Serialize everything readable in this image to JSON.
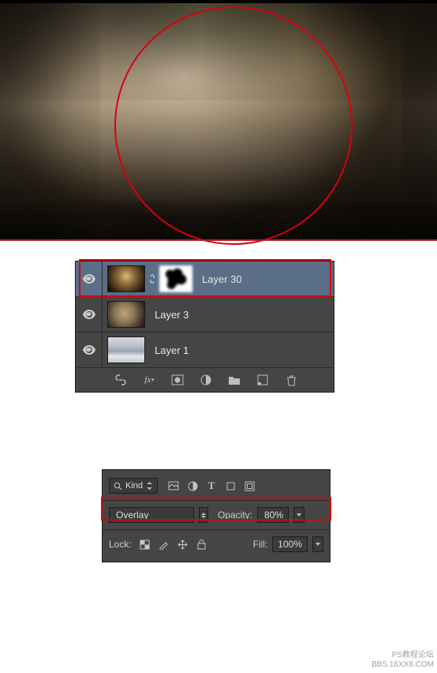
{
  "preview": {
    "annotation_shape": "circle"
  },
  "layersPanel": {
    "layers": [
      {
        "name": "Layer 30",
        "selected": true,
        "hasMask": true
      },
      {
        "name": "Layer 3",
        "selected": false,
        "hasMask": false
      },
      {
        "name": "Layer 1",
        "selected": false,
        "hasMask": false
      }
    ],
    "bottomIcons": [
      "link-icon",
      "fx-icon",
      "layer-mask-icon",
      "adjustment-icon",
      "group-icon",
      "new-layer-icon",
      "trash-icon"
    ]
  },
  "optionsPanel": {
    "filterKindLabel": "Kind",
    "blendMode": "Overlay",
    "opacityLabel": "Opacity:",
    "opacityValue": "80%",
    "lockLabel": "Lock:",
    "fillLabel": "Fill:",
    "fillValue": "100%"
  },
  "watermark": {
    "line1": "PS教程论坛",
    "line2": "BBS.16XX8.COM"
  }
}
